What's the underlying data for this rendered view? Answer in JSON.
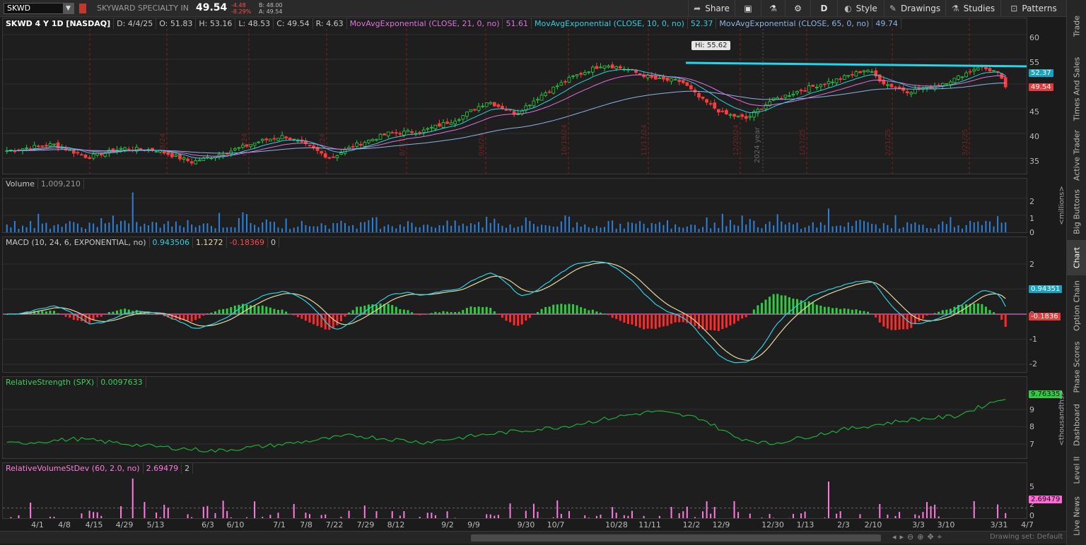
{
  "header": {
    "symbol": "SKWD",
    "company": "SKYWARD SPECIALTY IN",
    "last": "49.54",
    "change": "-4.48",
    "change_pct": "-8.29%",
    "bid": "B: 48.00",
    "ask": "A: 49.54",
    "buttons": [
      {
        "label": "Share",
        "icon": "share-icon"
      },
      {
        "label": "",
        "icon": "screenshot-icon"
      },
      {
        "label": "",
        "icon": "flask-icon"
      },
      {
        "label": "",
        "icon": "gear-icon"
      },
      {
        "label": "D",
        "icon": ""
      },
      {
        "label": "Style",
        "icon": "style-icon"
      },
      {
        "label": "Drawings",
        "icon": "pencil-icon"
      },
      {
        "label": "Studies",
        "icon": "studies-icon"
      },
      {
        "label": "Patterns",
        "icon": "patterns-icon"
      }
    ]
  },
  "price_pane": {
    "title": "SKWD 4 Y 1D [NASDAQ]",
    "ohlc": {
      "date": "D: 4/4/25",
      "open": "O: 51.83",
      "high": "H: 53.16",
      "low": "L: 48.53",
      "close": "C: 49.54",
      "range": "R: 4.63"
    },
    "studies": [
      {
        "label": "MovAvgExponential (CLOSE, 21, 0, no)",
        "value": "51.61",
        "color": "#e070e0"
      },
      {
        "label": "MovAvgExponential (CLOSE, 10, 0, no)",
        "value": "52.37",
        "color": "#30d0e0"
      },
      {
        "label": "MovAvgExponential (CLOSE, 65, 0, no)",
        "value": "49.74",
        "color": "#8ab4e8"
      }
    ],
    "hi_label": "Hi: 55.62",
    "axis_ticks": [
      "60",
      "55",
      "50",
      "45",
      "40",
      "35"
    ],
    "tag_ema10": "52.37",
    "tag_last": "49.54",
    "year_label": "2024 year",
    "period_markers": [
      "5/8/24",
      "6/7/24",
      "7/8/24",
      "8/7/24",
      "9/6/24",
      "10/18/24",
      "11/17/24",
      "12/20/24",
      "1/17/25",
      "2/21/25",
      "3/21/25"
    ]
  },
  "volume_pane": {
    "label": "Volume",
    "value": "1,009,210",
    "axis_ticks": [
      "2",
      "1",
      "0"
    ],
    "unit": "<millions>"
  },
  "macd_pane": {
    "label": "MACD (10, 24, 6, EXPONENTIAL, no)",
    "value": "0.943506",
    "avg": "1.1272",
    "diff": "-0.18369",
    "zero": "0",
    "axis_ticks": [
      "2",
      "1",
      "0",
      "-1",
      "-2"
    ],
    "tag_value": "0.94351",
    "tag_diff": "-0.1836"
  },
  "rs_pane": {
    "label": "RelativeStrength (SPX)",
    "value": "0.0097633",
    "axis_ticks": [
      "9",
      "8",
      "7"
    ],
    "tag_value": "9.76335",
    "unit": "<thousandths>"
  },
  "rvs_pane": {
    "label": "RelativeVolumeStDev (60, 2.0, no)",
    "value": "2.69479",
    "threshold": "2",
    "axis_ticks": [
      "5",
      "2",
      "0"
    ],
    "tag_value": "2.69479"
  },
  "date_axis": [
    "4/1",
    "4/8",
    "4/15",
    "4/29",
    "5/13",
    "6/3",
    "6/10",
    "7/1",
    "7/8",
    "7/22",
    "7/29",
    "8/12",
    "9/2",
    "9/9",
    "9/30",
    "10/7",
    "10/28",
    "11/11",
    "12/2",
    "12/9",
    "12/30",
    "1/13",
    "2/3",
    "2/10",
    "3/3",
    "3/10",
    "3/31",
    "4/7"
  ],
  "right_tabs": [
    "Trade",
    "Times And Sales",
    "Active Trader",
    "Big Buttons",
    "Chart",
    "Option Chain",
    "Phase Scores",
    "Dashboard",
    "Level II",
    "Live News"
  ],
  "status": "Drawing set: Default",
  "colors": {
    "up": "#2ecc40",
    "down": "#ff3b3b",
    "resistance": "#22d8ee",
    "macd_line": "#30d0e0",
    "macd_avg": "#e8d8a0",
    "rs_line": "#1fae3a",
    "rvs_bar": "#ff7ae0",
    "volume": "#2e7fd8"
  }
}
